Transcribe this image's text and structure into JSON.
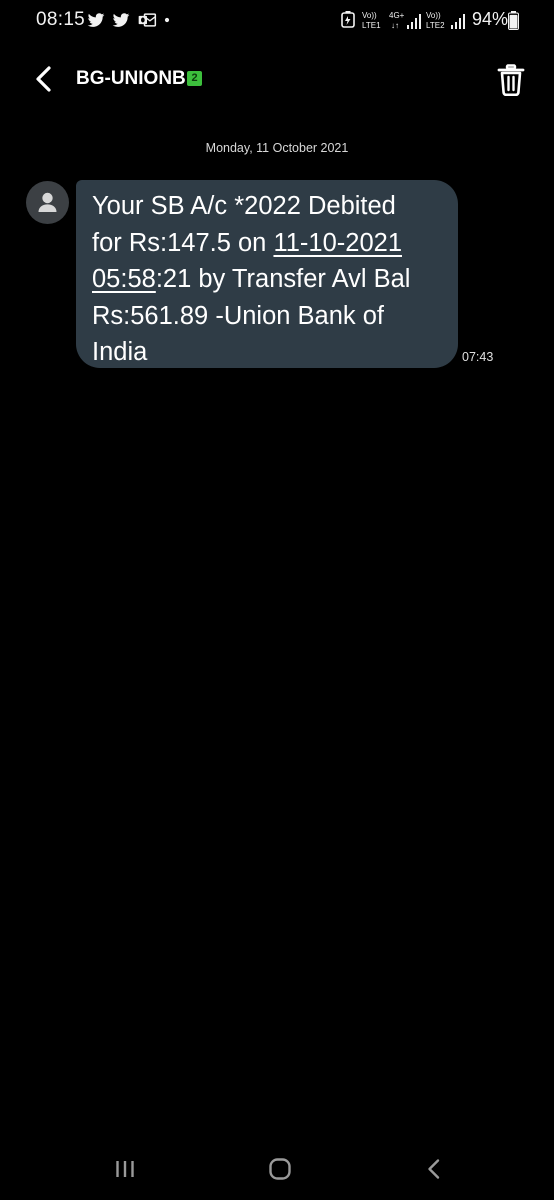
{
  "status_bar": {
    "time": "08:15",
    "notification_icons": [
      "twitter-icon",
      "twitter-icon",
      "outlook-icon",
      "dot-icon"
    ],
    "sim1_top": "Vo))",
    "sim1_bottom": "LTE1",
    "sim1_net_top": "4G+",
    "sim1_net_bottom": "↓↑",
    "sim2_top": "Vo))",
    "sim2_bottom": "LTE2",
    "battery_percent": "94%",
    "battery_level": 0.94
  },
  "header": {
    "contact_name": "BG-UNIONB",
    "sim_badge": "2"
  },
  "conversation": {
    "date_separator": "Monday, 11 October 2021",
    "message": {
      "line1": "Your SB A/c *2022 Debited",
      "line2_prefix": "for Rs:147.5 on ",
      "line2_link": "11-10-2021",
      "line3_link": "05:58",
      "line3_suffix": ":21 by Transfer Avl Bal",
      "line4": "Rs:561.89 -Union Bank of",
      "line5": "India",
      "time": "07:43"
    }
  },
  "colors": {
    "background": "#000000",
    "bubble": "#2f3c46",
    "sim_badge": "#3cbf3c"
  }
}
